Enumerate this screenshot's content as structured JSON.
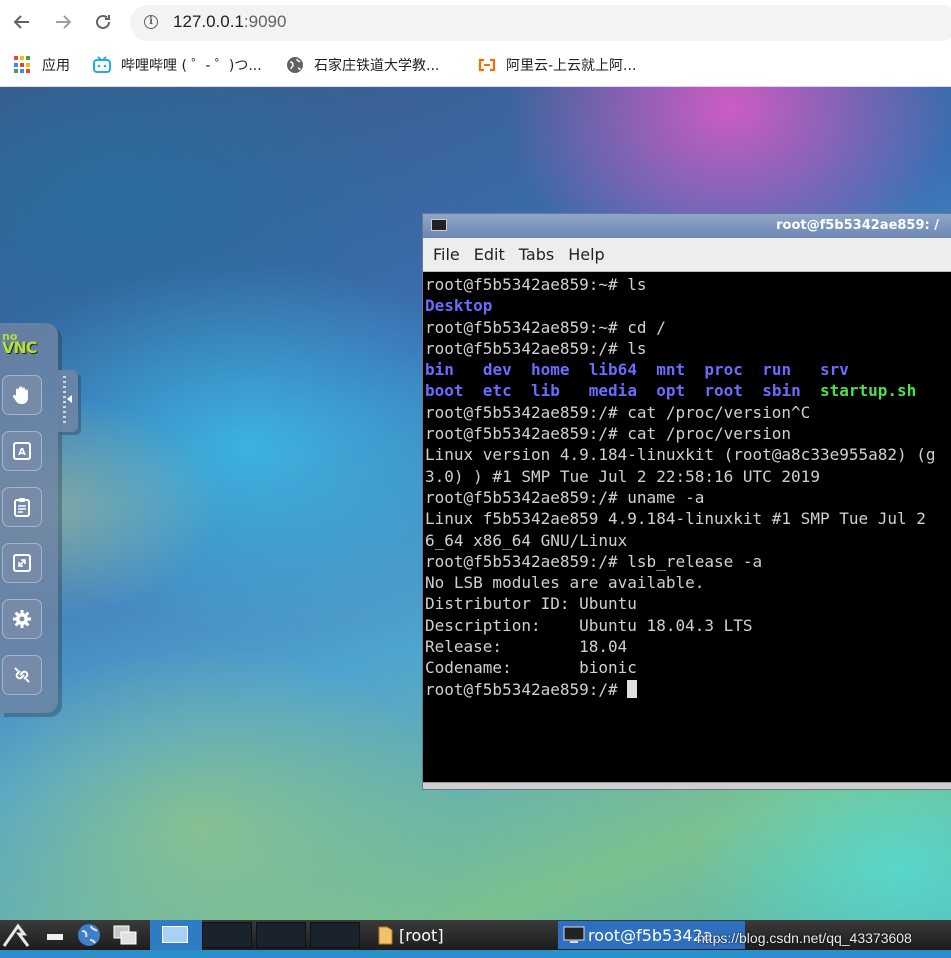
{
  "browser": {
    "url_host": "127.0.0.1",
    "url_port": ":9090",
    "nav": {
      "back_icon": "arrow-left-icon",
      "forward_icon": "arrow-right-icon",
      "reload_icon": "reload-icon"
    },
    "bookmarks": [
      {
        "label": "应用",
        "icon": "apps-grid-icon"
      },
      {
        "label": "哔哩哔哩 ( ゜- ゜)つ...",
        "icon": "bilibili-icon"
      },
      {
        "label": "石家庄铁道大学教...",
        "icon": "globe-icon"
      },
      {
        "label": "阿里云-上云就上阿...",
        "icon": "aliyun-icon"
      }
    ]
  },
  "novnc": {
    "logo_no": "no",
    "logo_vnc": "VNC",
    "buttons": [
      "drag-hand-icon",
      "keyboard-icon",
      "clipboard-icon",
      "fullscreen-icon",
      "settings-gear-icon",
      "disconnect-icon"
    ]
  },
  "terminal": {
    "title": "root@f5b5342ae859: /",
    "menu": [
      "File",
      "Edit",
      "Tabs",
      "Help"
    ],
    "lines": {
      "l1": "root@f5b5342ae859:~# ls",
      "l2": "Desktop",
      "l3": "root@f5b5342ae859:~# cd /",
      "l4": "root@f5b5342ae859:/# ls",
      "l5": [
        "bin",
        "dev",
        "home",
        "lib64",
        "mnt",
        "proc",
        "run",
        "srv"
      ],
      "l6": [
        "boot",
        "etc",
        "lib",
        "media",
        "opt",
        "root",
        "sbin"
      ],
      "l6_exec": "startup.sh",
      "l7": "root@f5b5342ae859:/# cat /proc/version^C",
      "l8": "root@f5b5342ae859:/# cat /proc/version",
      "l9": "Linux version 4.9.184-linuxkit (root@a8c33e955a82) (g",
      "l10": "3.0) ) #1 SMP Tue Jul 2 22:58:16 UTC 2019",
      "l11": "root@f5b5342ae859:/# uname -a",
      "l12": "Linux f5b5342ae859 4.9.184-linuxkit #1 SMP Tue Jul 2",
      "l13": "6_64 x86_64 GNU/Linux",
      "l14": "root@f5b5342ae859:/# lsb_release -a",
      "l15": "No LSB modules are available.",
      "l16": "Distributor ID: Ubuntu",
      "l17": "Description:    Ubuntu 18.04.3 LTS",
      "l18": "Release:        18.04",
      "l19": "Codename:       bionic",
      "l20": "root@f5b5342ae859:/# "
    }
  },
  "taskbar": {
    "tasks": [
      {
        "label": "[root]",
        "icon": "folder-icon"
      },
      {
        "label": "root@f5b5342a...",
        "icon": "terminal-icon"
      }
    ],
    "watermark": "https://blog.csdn.net/qq_43373608"
  },
  "colors": {
    "terminal_dir": "#6b6bff",
    "terminal_exec": "#4ce04c",
    "taskbar_active": "#2e6fbf"
  }
}
